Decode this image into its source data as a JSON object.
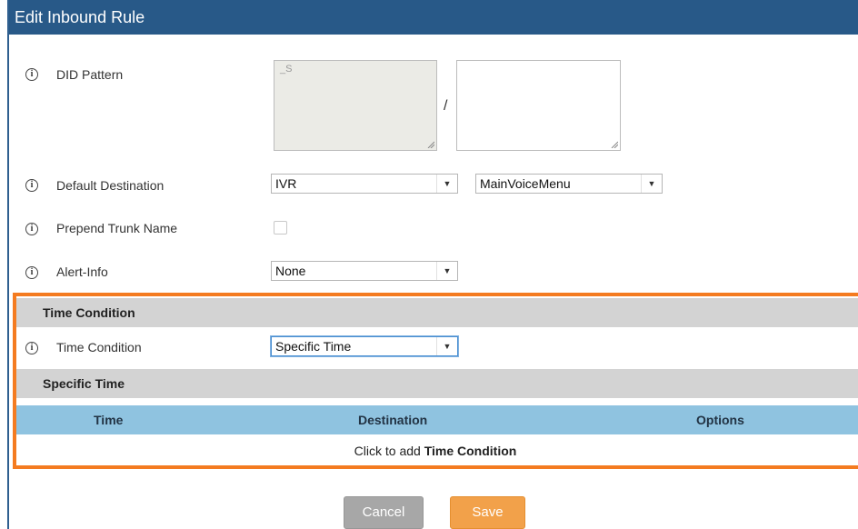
{
  "window": {
    "title": "Edit Inbound Rule"
  },
  "fields": {
    "did_pattern": {
      "label": "DID Pattern",
      "value_left": "_S",
      "value_right": "",
      "separator": "/"
    },
    "default_destination": {
      "label": "Default Destination",
      "type_value": "IVR",
      "target_value": "MainVoiceMenu"
    },
    "prepend_trunk_name": {
      "label": "Prepend Trunk Name",
      "checked": false
    },
    "alert_info": {
      "label": "Alert-Info",
      "value": "None"
    }
  },
  "time_condition": {
    "section_title": "Time Condition",
    "field_label": "Time Condition",
    "field_value": "Specific Time",
    "subsection_title": "Specific Time",
    "table": {
      "columns": [
        "Time",
        "Destination",
        "Options"
      ],
      "add_prefix": "Click to add ",
      "add_strong": "Time Condition"
    }
  },
  "buttons": {
    "cancel": "Cancel",
    "save": "Save"
  },
  "colors": {
    "title_bar": "#285988",
    "highlight_border": "#f47b20",
    "table_header": "#8fc3e0",
    "save_button": "#f2a14a",
    "cancel_button": "#a7a7a7"
  }
}
